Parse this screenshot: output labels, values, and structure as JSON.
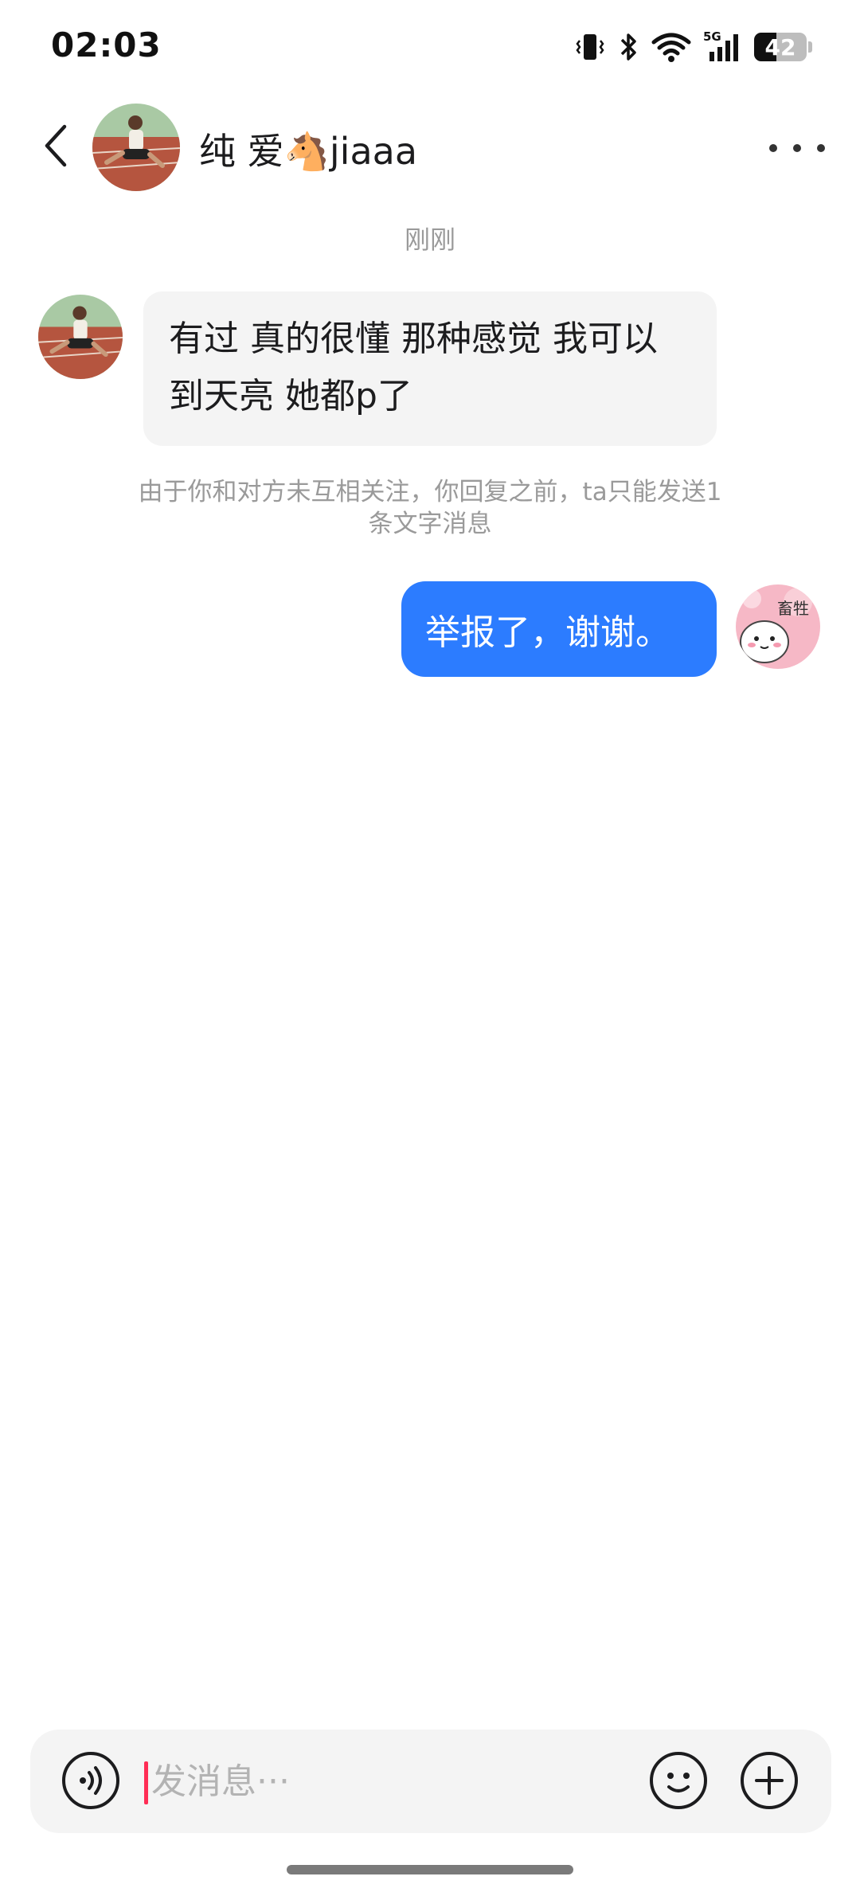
{
  "status_bar": {
    "time": "02:03",
    "network_label": "5G",
    "battery_level": "42",
    "icons": [
      "vibrate-icon",
      "bluetooth-icon",
      "wifi-icon",
      "signal-5g-icon",
      "battery-icon"
    ]
  },
  "header": {
    "back_icon": "chevron-left-icon",
    "contact_name": "纯 爱🐴jiaaa",
    "more_icon": "more-dots-icon"
  },
  "conversation": {
    "timestamp": "刚刚",
    "incoming": {
      "lines": [
        "有过 真的很懂 那种感觉 我可以",
        "到天亮 她都p了"
      ]
    },
    "system_notice": {
      "lines": [
        "由于你和对方未互相关注，你回复之前，ta只能发送1",
        "条文字消息"
      ]
    },
    "outgoing": {
      "text": "举报了，谢谢。",
      "avatar_sticker_text": "畜牲"
    }
  },
  "input_bar": {
    "placeholder": "发消息···",
    "value": "",
    "voice_icon": "voice-icon",
    "emoji_icon": "emoji-icon",
    "plus_icon": "plus-icon"
  },
  "colors": {
    "outgoing_bubble": "#2c7cff",
    "incoming_bubble": "#f4f4f4",
    "cursor": "#ff2d55",
    "meta_text": "#9a9a9a"
  }
}
